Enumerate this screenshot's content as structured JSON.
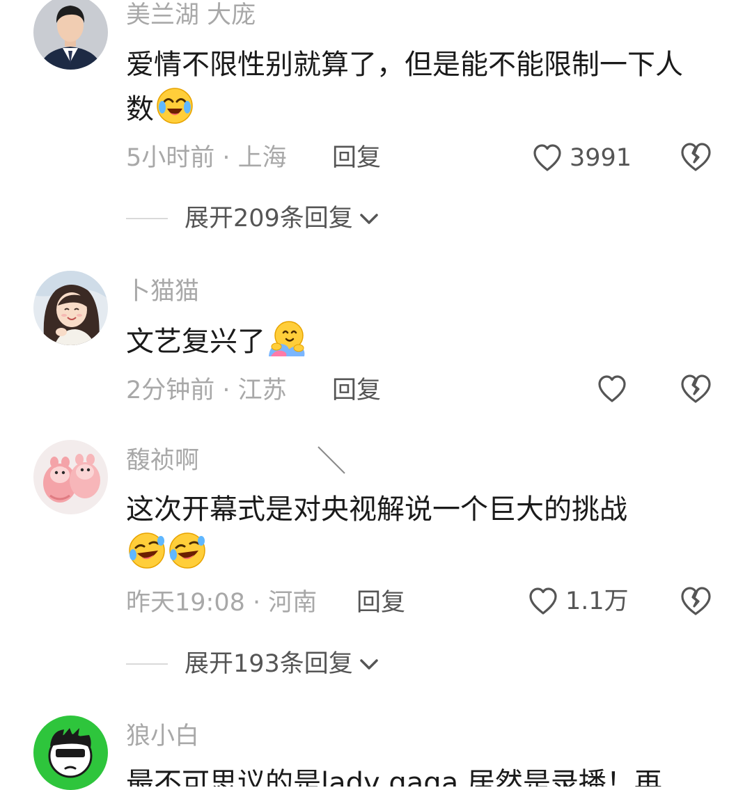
{
  "comments": [
    {
      "username": "美兰湖 大庞",
      "content": "爱情不限性别就算了，但是能不能限制一下人数",
      "emoji_icon": "crying-laughing-face-icon",
      "meta": "5小时前 · 上海",
      "reply_label": "回复",
      "likes": "3991",
      "expand_label": "展开209条回复"
    },
    {
      "username": "卜猫猫",
      "content": "文艺复兴了",
      "emoji_icon": "hug-face-icon",
      "meta": "2分钟前 · 江苏",
      "reply_label": "回复",
      "likes": ""
    },
    {
      "username": "馥祯啊",
      "content": "这次开幕式是对央视解说一个巨大的挑战",
      "emoji_icon": "rolling-laughing-face-icon",
      "meta": "昨天19:08 · 河南",
      "reply_label": "回复",
      "likes": "1.1万",
      "expand_label": "展开193条回复"
    },
    {
      "username": "狼小白",
      "content": "最不可思议的是lady gaga 居然是录播！再"
    }
  ],
  "colors": {
    "secondary_text": "#a8a8a8",
    "action_text": "#555555",
    "primary_text": "#1a1a1a",
    "divider": "#d9d9d9",
    "avatar4_bg": "#2ec53c"
  }
}
